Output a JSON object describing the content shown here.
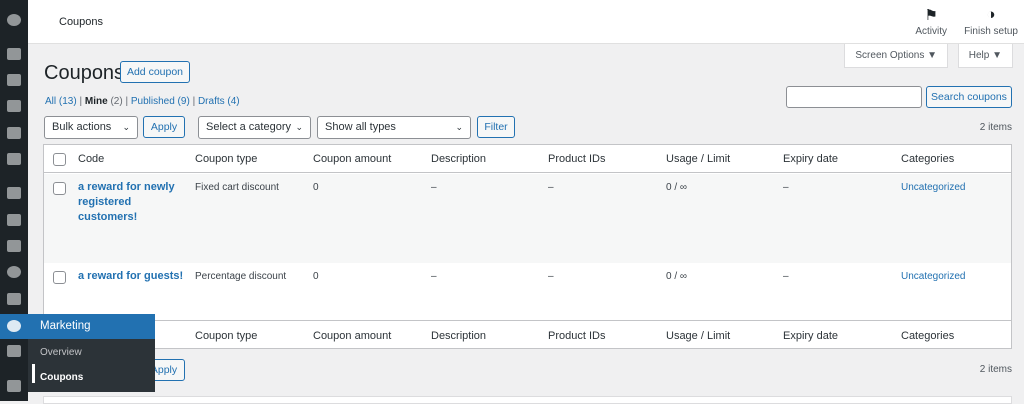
{
  "header": {
    "title": "Coupons",
    "activity": "Activity",
    "finish_setup": "Finish setup"
  },
  "screen_options": "Screen Options ▼",
  "help": "Help ▼",
  "page": {
    "title": "Coupons",
    "add_button": "Add coupon"
  },
  "views": {
    "all": "All",
    "all_count": "(13)",
    "mine": "Mine",
    "mine_count": "(2)",
    "published": "Published",
    "published_count": "(9)",
    "drafts": "Drafts",
    "drafts_count": "(4)",
    "sep": "|"
  },
  "search": {
    "value": "",
    "button": "Search coupons"
  },
  "filters": {
    "bulk": "Bulk actions",
    "apply": "Apply",
    "category": "Select a category",
    "types": "Show all types",
    "filter": "Filter"
  },
  "items_count": "2 items",
  "columns": [
    "Code",
    "Coupon type",
    "Coupon amount",
    "Description",
    "Product IDs",
    "Usage / Limit",
    "Expiry date",
    "Categories"
  ],
  "rows": [
    {
      "code": "a reward for newly registered customers!",
      "type": "Fixed cart discount",
      "amount": "0",
      "description": "–",
      "product_ids": "–",
      "usage": "0 / ∞",
      "expiry": "–",
      "categories": "Uncategorized"
    },
    {
      "code": "a reward for guests!",
      "type": "Percentage discount",
      "amount": "0",
      "description": "–",
      "product_ids": "–",
      "usage": "0 / ∞",
      "expiry": "–",
      "categories": "Uncategorized"
    }
  ],
  "menu": {
    "marketing": "Marketing",
    "overview": "Overview",
    "coupons": "Coupons"
  },
  "colors": {
    "accent": "#2271b1",
    "sidebar": "#1d2327"
  }
}
